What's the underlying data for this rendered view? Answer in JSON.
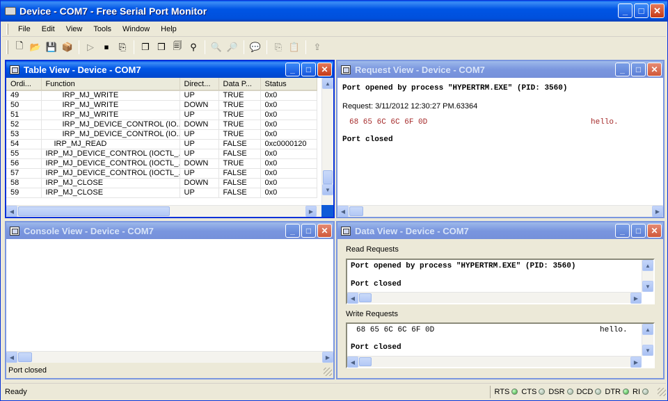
{
  "window": {
    "title": "Device - COM7 - Free Serial Port Monitor",
    "min_glyph": "_",
    "max_glyph": "□",
    "close_glyph": "✕"
  },
  "menu": [
    "File",
    "Edit",
    "View",
    "Tools",
    "Window",
    "Help"
  ],
  "toolbar": {
    "tools": [
      {
        "icon": "new-icon",
        "glyph": "🗋",
        "enabled": true
      },
      {
        "icon": "open-icon",
        "glyph": "📂",
        "enabled": true
      },
      {
        "icon": "save-icon",
        "glyph": "💾",
        "enabled": true
      },
      {
        "icon": "package-icon",
        "glyph": "📦",
        "enabled": true
      },
      {
        "sep": true
      },
      {
        "icon": "start-icon",
        "glyph": "▷",
        "enabled": false
      },
      {
        "icon": "stop-icon",
        "glyph": "⏹",
        "enabled": true
      },
      {
        "icon": "clear-icon",
        "glyph": "⎘",
        "enabled": true
      },
      {
        "sep": true
      },
      {
        "icon": "table-view-icon",
        "glyph": "❐",
        "enabled": true
      },
      {
        "icon": "request-view-icon",
        "glyph": "❒",
        "enabled": true
      },
      {
        "icon": "console-view-icon",
        "glyph": "🗐",
        "enabled": true
      },
      {
        "icon": "data-view-icon",
        "glyph": "⚲",
        "enabled": true
      },
      {
        "sep": true
      },
      {
        "icon": "find-icon",
        "glyph": "🔍",
        "enabled": false
      },
      {
        "icon": "find-next-icon",
        "glyph": "🔎",
        "enabled": false
      },
      {
        "sep": true
      },
      {
        "icon": "help-icon",
        "glyph": "💬",
        "enabled": true
      },
      {
        "sep": true
      },
      {
        "icon": "copy-icon",
        "glyph": "⎘",
        "enabled": false
      },
      {
        "icon": "paste-icon",
        "glyph": "📋",
        "enabled": false
      },
      {
        "sep": true
      },
      {
        "icon": "export-icon",
        "glyph": "⇪",
        "enabled": false
      }
    ]
  },
  "table_view": {
    "title": "Table View - Device - COM7",
    "columns": [
      "Ordi...",
      "Function",
      "Direct...",
      "Data P...",
      "Status"
    ],
    "rows": [
      {
        "ord": "49",
        "func": "IRP_MJ_WRITE",
        "indent": 2,
        "dir": "UP",
        "data": "TRUE",
        "status": "0x0"
      },
      {
        "ord": "50",
        "func": "IRP_MJ_WRITE",
        "indent": 2,
        "dir": "DOWN",
        "data": "TRUE",
        "status": "0x0"
      },
      {
        "ord": "51",
        "func": "IRP_MJ_WRITE",
        "indent": 2,
        "dir": "UP",
        "data": "TRUE",
        "status": "0x0"
      },
      {
        "ord": "52",
        "func": "IRP_MJ_DEVICE_CONTROL (IO...",
        "indent": 2,
        "dir": "DOWN",
        "data": "TRUE",
        "status": "0x0"
      },
      {
        "ord": "53",
        "func": "IRP_MJ_DEVICE_CONTROL (IO...",
        "indent": 2,
        "dir": "UP",
        "data": "TRUE",
        "status": "0x0"
      },
      {
        "ord": "54",
        "func": "IRP_MJ_READ",
        "indent": 1,
        "dir": "UP",
        "data": "FALSE",
        "status": "0xc0000120"
      },
      {
        "ord": "55",
        "func": "IRP_MJ_DEVICE_CONTROL (IOCTL_...",
        "indent": 0,
        "dir": "UP",
        "data": "FALSE",
        "status": "0x0"
      },
      {
        "ord": "56",
        "func": "IRP_MJ_DEVICE_CONTROL (IOCTL_...",
        "indent": 0,
        "dir": "DOWN",
        "data": "TRUE",
        "status": "0x0"
      },
      {
        "ord": "57",
        "func": "IRP_MJ_DEVICE_CONTROL (IOCTL_...",
        "indent": 0,
        "dir": "UP",
        "data": "FALSE",
        "status": "0x0"
      },
      {
        "ord": "58",
        "func": "IRP_MJ_CLOSE",
        "indent": 0,
        "dir": "DOWN",
        "data": "FALSE",
        "status": "0x0"
      },
      {
        "ord": "59",
        "func": "IRP_MJ_CLOSE",
        "indent": 0,
        "dir": "UP",
        "data": "FALSE",
        "status": "0x0"
      }
    ]
  },
  "request_view": {
    "title": "Request View - Device - COM7",
    "port_opened": "Port opened by process \"HYPERTRM.EXE\" (PID: 3560)",
    "request_line": "Request: 3/11/2012 12:30:27 PM.63364",
    "hex": "68 65 6C 6C 6F 0D",
    "ascii": "hello.",
    "port_closed": "Port closed"
  },
  "console_view": {
    "title": "Console View - Device - COM7",
    "status": "Port closed"
  },
  "data_view": {
    "title": "Data View - Device - COM7",
    "read_label": "Read Requests",
    "read_line1": "Port opened by process \"HYPERTRM.EXE\" (PID: 3560)",
    "read_line2": "Port closed",
    "write_label": "Write Requests",
    "write_hex": "68 65 6C 6C 6F 0D",
    "write_ascii": "hello.",
    "write_line2": "Port closed"
  },
  "statusbar": {
    "ready": "Ready",
    "signals": [
      {
        "name": "RTS",
        "on": true
      },
      {
        "name": "CTS",
        "on": false
      },
      {
        "name": "DSR",
        "on": false
      },
      {
        "name": "DCD",
        "on": false
      },
      {
        "name": "DTR",
        "on": true
      },
      {
        "name": "RI",
        "on": false
      }
    ]
  },
  "colors": {
    "title_active": "#0055e5",
    "title_inactive": "#7a96df",
    "hex_data": "#a52a2a",
    "signal_on": "#2fa22f"
  }
}
